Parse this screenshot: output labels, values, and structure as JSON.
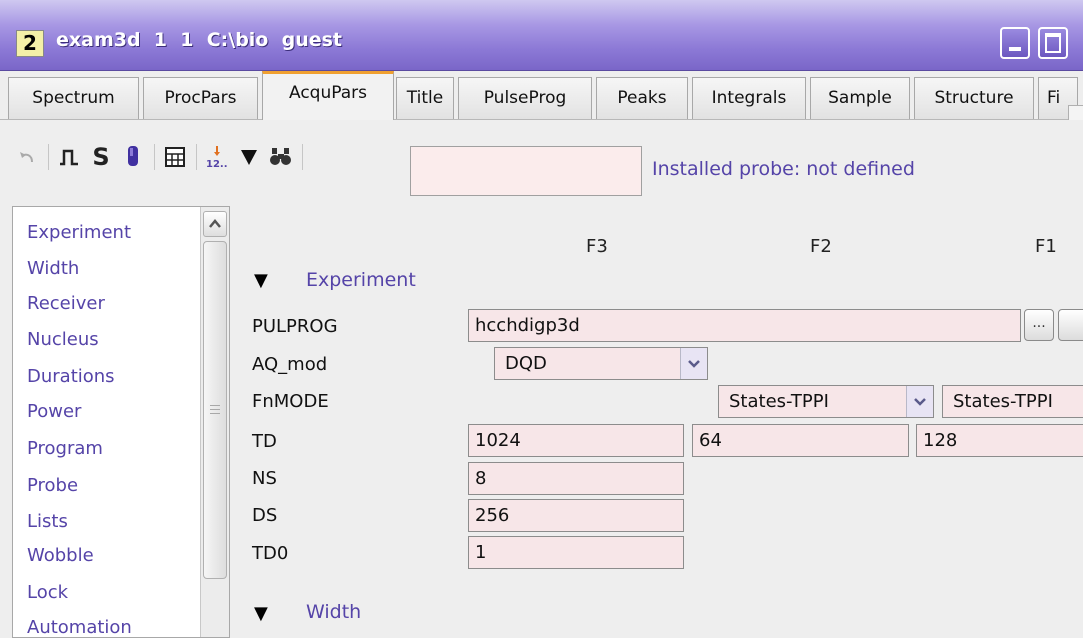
{
  "window": {
    "number": "2",
    "title": "exam3d  1  1  C:\\bio  guest"
  },
  "tabs": [
    {
      "label": "Spectrum"
    },
    {
      "label": "ProcPars"
    },
    {
      "label": "AcquPars",
      "active": true
    },
    {
      "label": "Title"
    },
    {
      "label": "PulseProg"
    },
    {
      "label": "Peaks"
    },
    {
      "label": "Integrals"
    },
    {
      "label": "Sample"
    },
    {
      "label": "Structure"
    },
    {
      "label": "Fi"
    }
  ],
  "toolbar": {
    "icons": [
      "undo-icon",
      "pulse-icon",
      "s-icon",
      "probe-icon",
      "table-icon",
      "sort-numbers-icon",
      "triangle-down-icon",
      "binoculars-icon"
    ],
    "s_label": "S",
    "search_value": "",
    "probe_status": "Installed probe: not defined"
  },
  "sidebar": {
    "items": [
      "Experiment",
      "Width",
      "Receiver",
      "Nucleus",
      "Durations",
      "Power",
      "Program",
      "Probe",
      "Lists",
      "Wobble",
      "Lock",
      "Automation"
    ]
  },
  "main": {
    "columns": [
      "F3",
      "F2",
      "F1"
    ],
    "sections": [
      {
        "title": "Experiment"
      },
      {
        "title": "Width"
      }
    ],
    "params": {
      "pulprog": {
        "label": "PULPROG",
        "value": "hcchdigp3d",
        "button_label": "..."
      },
      "aq_mod": {
        "label": "AQ_mod",
        "value": "DQD"
      },
      "fnmode": {
        "label": "FnMODE",
        "f2": "States-TPPI",
        "f1": "States-TPPI"
      },
      "td": {
        "label": "TD",
        "f3": "1024",
        "f2": "64",
        "f1": "128"
      },
      "ns": {
        "label": "NS",
        "value": "8"
      },
      "ds": {
        "label": "DS",
        "value": "256"
      },
      "td0": {
        "label": "TD0",
        "value": "1"
      }
    }
  },
  "colors": {
    "title_bar": "#8c79d6",
    "link_text": "#5544a8",
    "field_bg": "#f7e6e8",
    "active_tab_accent": "#f0a030"
  }
}
